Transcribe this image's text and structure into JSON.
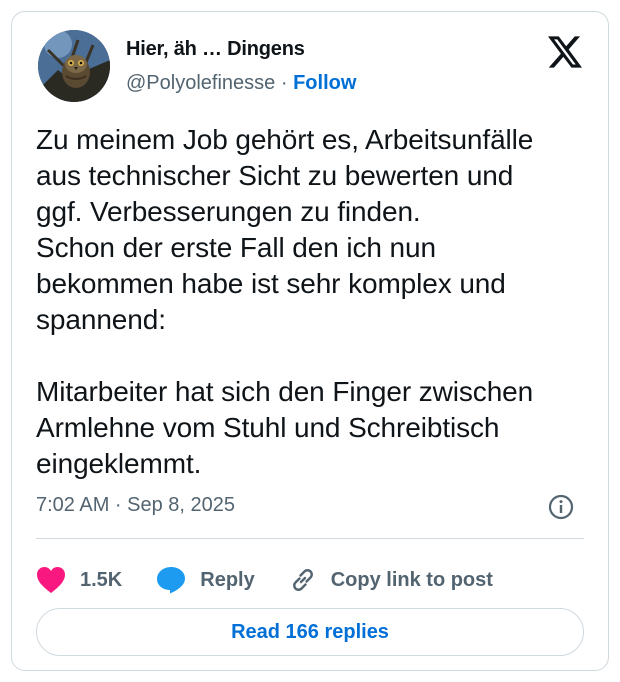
{
  "author": {
    "display_name": "Hier, äh … Dingens",
    "handle": "@Polyolefinesse",
    "separator": "·",
    "follow_label": "Follow",
    "avatar_icon": "owl-avatar-icon"
  },
  "tweet": {
    "text": "Zu meinem Job gehört es, Arbeitsunfälle\naus technischer Sicht zu bewerten und\nggf. Verbesserungen zu finden.\nSchon der erste Fall den ich nun\nbekommen habe ist sehr komplex und\nspannend:\n\nMitarbeiter hat sich den Finger zwischen\nArmlehne vom Stuhl und Schreibtisch\neingeklemmt.",
    "timestamp": "7:02 AM · Sep 8, 2025"
  },
  "actions": {
    "likes": "1.5K",
    "reply_label": "Reply",
    "copy_link_label": "Copy link to post",
    "read_replies_label": "Read 166 replies"
  },
  "colors": {
    "like": "#f91880",
    "reply": "#1d9bf0",
    "link": "#006fd6",
    "muted": "#536471",
    "border": "#cfd9de"
  }
}
